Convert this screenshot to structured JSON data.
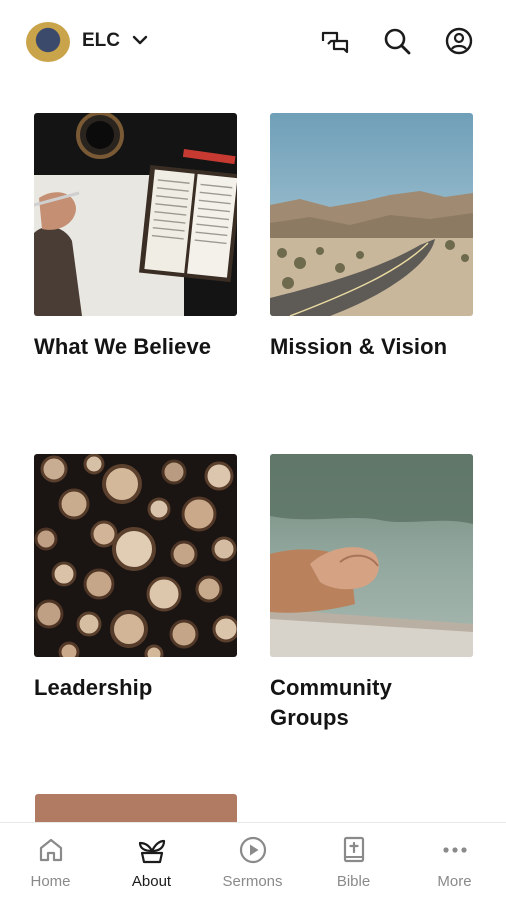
{
  "header": {
    "org_name": "ELC",
    "icons": [
      "logo-icon",
      "chevron-down-icon",
      "chat-icon",
      "search-icon",
      "profile-icon"
    ]
  },
  "cards": [
    {
      "title": "What We Believe",
      "image": "open-bible-notebook-photo"
    },
    {
      "title": "Mission & Vision",
      "image": "desert-road-photo"
    },
    {
      "title": "Leadership",
      "image": "stacked-logs-photo"
    },
    {
      "title": "Community\nGroups",
      "image": "hands-lake-photo"
    }
  ],
  "bottom_nav": {
    "items": [
      {
        "label": "Home",
        "icon": "home-icon",
        "active": false
      },
      {
        "label": "About",
        "icon": "plant-icon",
        "active": true
      },
      {
        "label": "Sermons",
        "icon": "play-circle-icon",
        "active": false
      },
      {
        "label": "Bible",
        "icon": "bible-icon",
        "active": false
      },
      {
        "label": "More",
        "icon": "more-dots-icon",
        "active": false
      }
    ]
  },
  "colors": {
    "active_text": "#1c1c1c",
    "inactive_text": "#8a8a8a",
    "partial_card": "#b07b62"
  }
}
